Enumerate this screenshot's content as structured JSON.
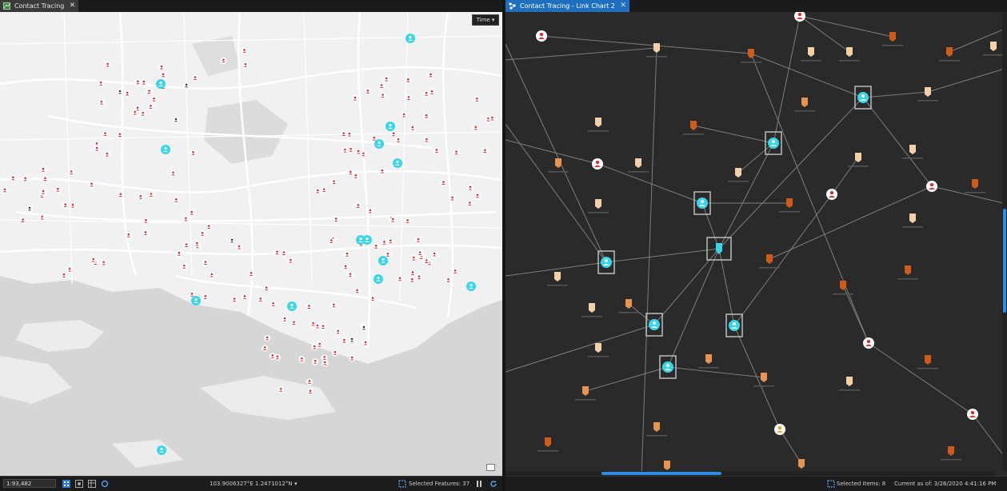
{
  "left_pane": {
    "tab_label": "Contact Tracing",
    "close_glyph": "✕",
    "time_button": "Time ▾",
    "status": {
      "scale": "1:93,482",
      "coordinates": "103.9006327°E 1.2471012°N",
      "coordinate_dropdown": "▾",
      "selected_features": "Selected Features: 37"
    }
  },
  "right_pane": {
    "tab_label": "Contact Tracing - Link Chart 2",
    "close_glyph": "✕",
    "status": {
      "selected_items": "Selected Items: 8",
      "current_as_of": "Current as of: 3/26/2020 4:41:16 PM"
    }
  },
  "icons": {
    "tab": "map-tab-icon",
    "link_chart_tab": "link-chart-tab-icon",
    "person": "person-icon",
    "pin": "pin-icon"
  },
  "colors": {
    "case_red": "#d9252b",
    "cyan": "#38d6e8",
    "dark_person": "#333333",
    "pin_light": "#f5cfa8",
    "pin_mid": "#e79352",
    "pin_dark": "#cf5a1a",
    "selected_accent": "#1f6fbf"
  }
}
